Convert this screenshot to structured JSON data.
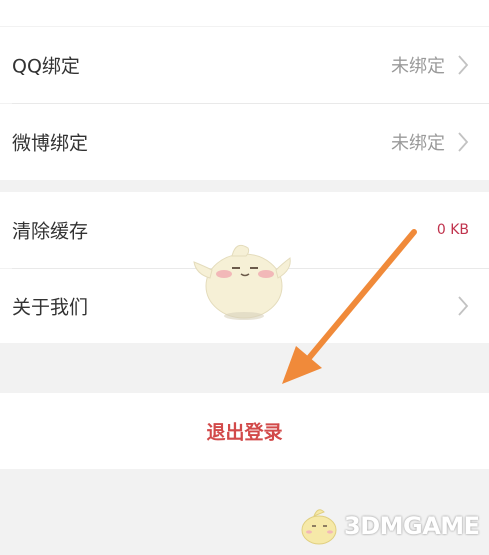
{
  "settings": {
    "qq_binding": {
      "label": "QQ绑定",
      "value": "未绑定"
    },
    "weibo_binding": {
      "label": "微博绑定",
      "value": "未绑定"
    },
    "clear_cache": {
      "label": "清除缓存",
      "value": "0 KB"
    },
    "about_us": {
      "label": "关于我们"
    },
    "logout_label": "退出登录"
  },
  "watermark": {
    "brand": "3DMGAME"
  },
  "colors": {
    "page_bg": "#f2f2f2",
    "row_bg": "#ffffff",
    "accent_red": "#d24a4a",
    "cache_value": "#c0334d",
    "arrow": "#f08a3a"
  },
  "icons": [
    "chevron-right-icon",
    "mascot-sticker",
    "annotation-arrow",
    "3dmgame-logo"
  ]
}
